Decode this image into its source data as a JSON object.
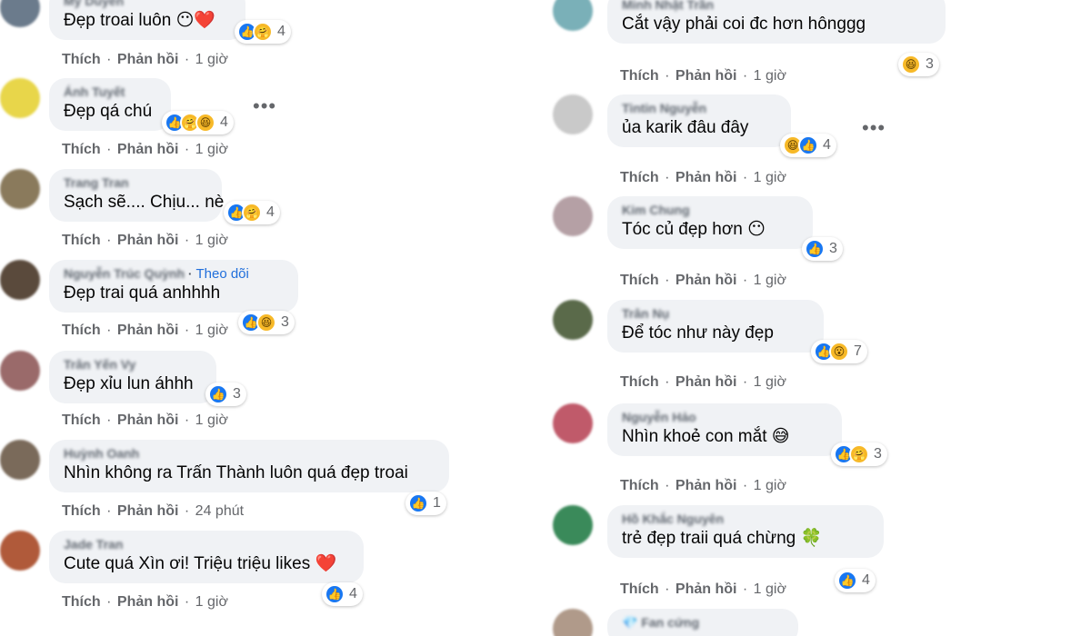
{
  "actions": {
    "like": "Thích",
    "reply": "Phản hồi",
    "dot": "·"
  },
  "left": [
    {
      "author": "Mỹ Duyên",
      "text": "Đẹp troai luôn",
      "emoji": "😶❤️",
      "reactions": [
        "like",
        "care"
      ],
      "count": "4",
      "time": "1 giờ"
    },
    {
      "author": "Ánh Tuyết",
      "text": "Đẹp qá chú",
      "emoji": "",
      "reactions": [
        "like",
        "care",
        "haha"
      ],
      "count": "4",
      "time": "1 giờ"
    },
    {
      "author": "Trang Tran",
      "text": "Sạch sẽ.... Chịu... nè",
      "emoji": "",
      "reactions": [
        "like",
        "care"
      ],
      "count": "4",
      "time": "1 giờ"
    },
    {
      "author": "Nguyễn Trúc Quỳnh",
      "follow": "Theo dõi",
      "text": "Đẹp trai quá anhhhh",
      "emoji": "",
      "reactions": [
        "like",
        "haha"
      ],
      "count": "3",
      "time": "1 giờ"
    },
    {
      "author": "Trân Yến Vy",
      "text": "Đẹp xỉu lun áhhh",
      "emoji": "",
      "reactions": [
        "like"
      ],
      "count": "3",
      "time": "1 giờ"
    },
    {
      "author": "Huỳnh Oanh",
      "text": "Nhìn không ra Trấn Thành luôn quá đẹp troai",
      "emoji": "",
      "reactions": [
        "like"
      ],
      "count": "1",
      "time": "24 phút"
    },
    {
      "author": "Jade Tran",
      "text": "Cute quá Xìn ơi! Triệu triệu likes",
      "emoji": "❤️",
      "reactions": [
        "like"
      ],
      "count": "4",
      "time": "1 giờ"
    }
  ],
  "right": [
    {
      "author": "Minh Nhật Trần",
      "text": "Cắt vậy phải coi đc hơn hônggg",
      "emoji": "",
      "reactions": [
        "haha"
      ],
      "count": "3",
      "time": "1 giờ"
    },
    {
      "author": "Tintin Nguyễn",
      "text": "ủa karik đâu đây",
      "emoji": "",
      "reactions": [
        "haha",
        "like"
      ],
      "count": "4",
      "time": "1 giờ"
    },
    {
      "author": "Kim Chung",
      "text": "Tóc củ đẹp hơn",
      "emoji": "😶",
      "reactions": [
        "like"
      ],
      "count": "3",
      "time": "1 giờ"
    },
    {
      "author": "Trân Nụ",
      "text": "Để tóc như này đẹp",
      "emoji": "",
      "reactions": [
        "like",
        "wow"
      ],
      "count": "7",
      "time": "1 giờ"
    },
    {
      "author": "Nguyễn Hảo",
      "text": "Nhìn khoẻ con mắt",
      "emoji": "😅",
      "reactions": [
        "like",
        "care"
      ],
      "count": "3",
      "time": "1 giờ"
    },
    {
      "author": "Hồ Khắc Nguyên",
      "text": "trẻ đẹp traii quá chừng",
      "emoji": "🍀",
      "reactions": [
        "like"
      ],
      "count": "4",
      "time": "1 giờ"
    },
    {
      "author": "💎 Fan cứng",
      "text": "",
      "emoji": "",
      "reactions": [],
      "count": "",
      "time": ""
    }
  ],
  "icons": {
    "like": "👍",
    "care": "🤗",
    "haha": "😆",
    "wow": "😮",
    "love": "❤",
    "more": "•••"
  },
  "colors": {
    "like": "#1877f2",
    "bubble": "#f0f2f5",
    "link": "#216fdb",
    "muted": "#65676b"
  }
}
